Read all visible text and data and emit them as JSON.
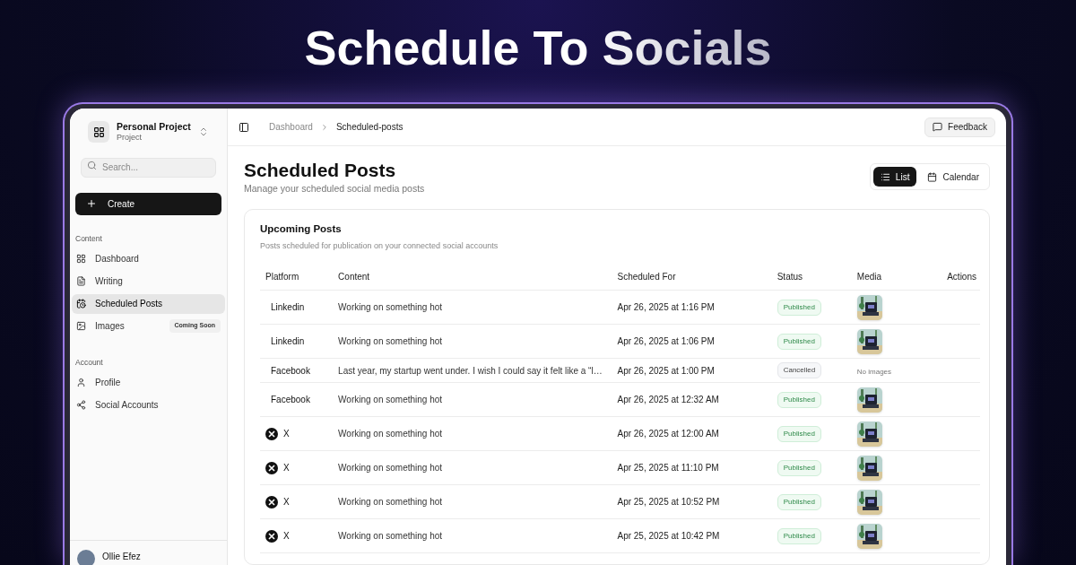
{
  "headline": "Schedule To Socials",
  "workspace": {
    "name": "Personal Project",
    "subtitle": "Project"
  },
  "search": {
    "placeholder": "Search..."
  },
  "create_button": "Create",
  "sidebar": [
    {
      "heading": "Content",
      "items": [
        {
          "label": "Dashboard",
          "selected": false
        },
        {
          "label": "Writing",
          "selected": false
        },
        {
          "label": "Scheduled Posts",
          "selected": true
        },
        {
          "label": "Images",
          "selected": false,
          "badge": "Coming Soon"
        }
      ]
    },
    {
      "heading": "Account",
      "items": [
        {
          "label": "Profile",
          "selected": false
        },
        {
          "label": "Social Accounts",
          "selected": false
        }
      ]
    }
  ],
  "user": {
    "name": "Ollie Efez"
  },
  "breadcrumb": [
    "Dashboard",
    "Scheduled-posts"
  ],
  "feedback_button": "Feedback",
  "page": {
    "title": "Scheduled Posts",
    "subtitle": "Manage your scheduled social media posts"
  },
  "view_toggle": [
    {
      "label": "List",
      "selected": true
    },
    {
      "label": "Calendar",
      "selected": false
    }
  ],
  "card": {
    "title": "Upcoming Posts",
    "subtitle": "Posts scheduled for publication on your connected social accounts"
  },
  "table": {
    "columns": [
      "Platform",
      "Content",
      "Scheduled For",
      "Status",
      "Media",
      "Actions"
    ],
    "rows": [
      {
        "platform": {
          "label": "Linkedin",
          "kind": "text"
        },
        "content": "Working on something hot",
        "scheduled": "Apr 26, 2025 at 1:16 PM",
        "status": {
          "label": "Published",
          "kind": "published"
        }
      },
      {
        "platform": {
          "label": "Linkedin",
          "kind": "text"
        },
        "content": "Working on something hot",
        "scheduled": "Apr 26, 2025 at 1:06 PM",
        "status": {
          "label": "Published",
          "kind": "published"
        }
      },
      {
        "platform": {
          "label": "Facebook",
          "kind": "text"
        },
        "content": "Last year, my startup went under. I wish I could say it felt like a “l…",
        "scheduled": "Apr 26, 2025 at 1:00 PM",
        "status": {
          "label": "Cancelled",
          "kind": "cancelled"
        },
        "media": {
          "kind": "none",
          "text": "No images"
        }
      },
      {
        "platform": {
          "label": "Facebook",
          "kind": "text"
        },
        "content": "Working on something hot",
        "scheduled": "Apr 26, 2025 at 12:32 AM",
        "status": {
          "label": "Published",
          "kind": "published"
        }
      },
      {
        "platform": {
          "label": "X",
          "kind": "x"
        },
        "content": "Working on something hot",
        "scheduled": "Apr 26, 2025 at 12:00 AM",
        "status": {
          "label": "Published",
          "kind": "published"
        }
      },
      {
        "platform": {
          "label": "X",
          "kind": "x"
        },
        "content": "Working on something hot",
        "scheduled": "Apr 25, 2025 at 11:10 PM",
        "status": {
          "label": "Published",
          "kind": "published"
        }
      },
      {
        "platform": {
          "label": "X",
          "kind": "x"
        },
        "content": "Working on something hot",
        "scheduled": "Apr 25, 2025 at 10:52 PM",
        "status": {
          "label": "Published",
          "kind": "published"
        }
      },
      {
        "platform": {
          "label": "X",
          "kind": "x"
        },
        "content": "Working on something hot",
        "scheduled": "Apr 25, 2025 at 10:42 PM",
        "status": {
          "label": "Published",
          "kind": "published"
        }
      }
    ]
  }
}
